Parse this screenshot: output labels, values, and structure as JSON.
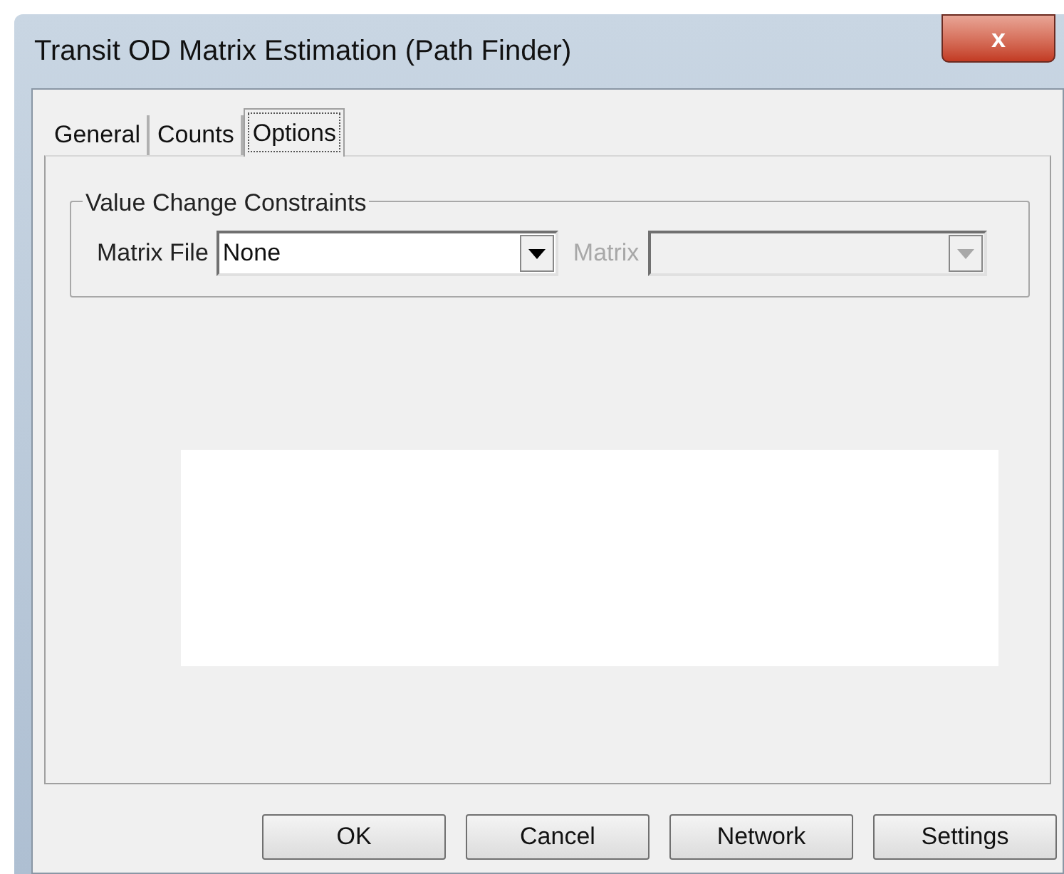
{
  "window": {
    "title": "Transit OD Matrix Estimation (Path Finder)",
    "close": "x"
  },
  "tabs": [
    {
      "label": "General",
      "selected": false
    },
    {
      "label": "Counts",
      "selected": false
    },
    {
      "label": "Options",
      "selected": true
    }
  ],
  "group": {
    "title": "Value Change Constraints",
    "fields": [
      {
        "label": "Matrix File",
        "value": "None",
        "disabled": false
      },
      {
        "label": "Matrix",
        "disabled": true
      }
    ]
  },
  "buttons": [
    "OK",
    "Cancel",
    "Network",
    "Settings"
  ]
}
